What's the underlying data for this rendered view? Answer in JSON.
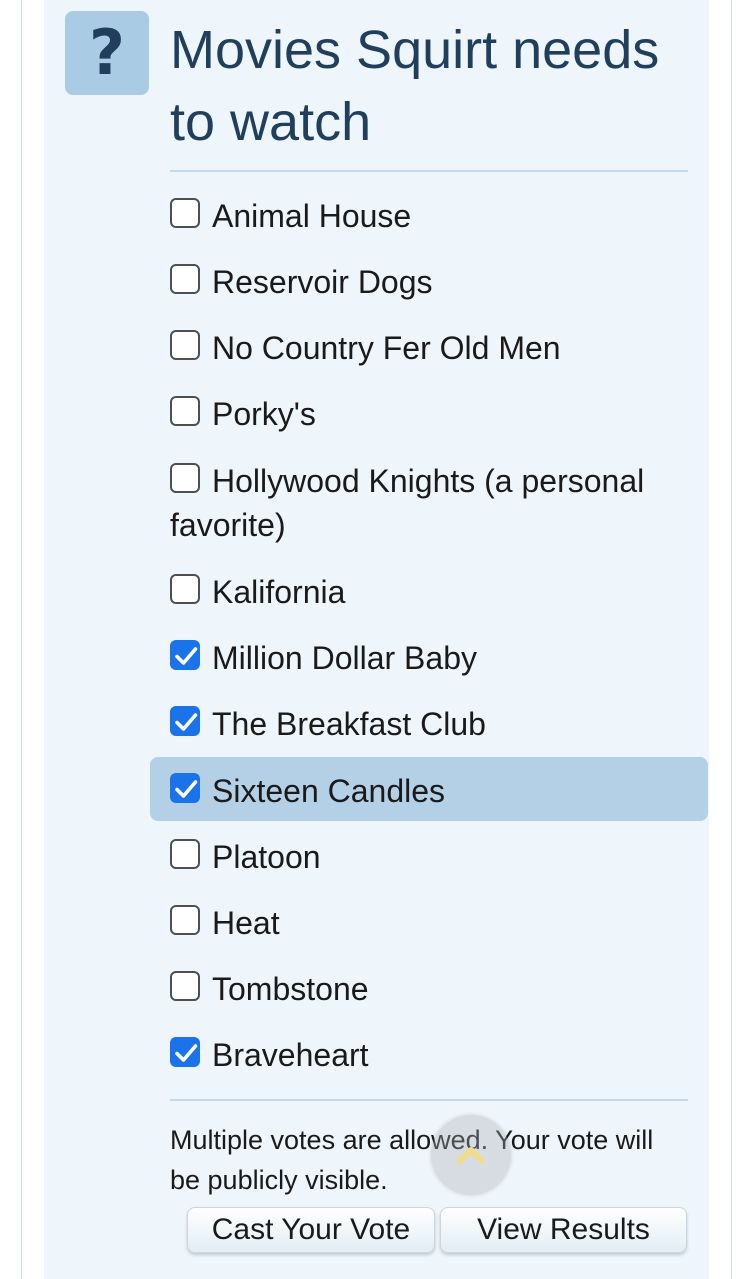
{
  "poll": {
    "icon_glyph": "?",
    "title": "Movies Squirt needs to watch",
    "options": [
      {
        "label": "Animal House",
        "checked": false
      },
      {
        "label": "Reservoir Dogs",
        "checked": false
      },
      {
        "label": "No Country Fer Old Men",
        "checked": false
      },
      {
        "label": "Porky's",
        "checked": false
      },
      {
        "label": "Hollywood Knights (a personal favorite)",
        "checked": false
      },
      {
        "label": "Kalifornia",
        "checked": false
      },
      {
        "label": "Million Dollar Baby",
        "checked": true
      },
      {
        "label": "The Breakfast Club",
        "checked": true
      },
      {
        "label": "Sixteen Candles",
        "checked": true
      },
      {
        "label": "Platoon",
        "checked": false
      },
      {
        "label": "Heat",
        "checked": false
      },
      {
        "label": "Tombstone",
        "checked": false
      },
      {
        "label": "Braveheart",
        "checked": true
      }
    ],
    "note": "Multiple votes are allowed. Your vote will be publicly visible.",
    "cast_vote_label": "Cast Your Vote",
    "view_results_label": "View Results"
  },
  "icons": {
    "question": "question-mark-icon",
    "checkbox_checked": "checkmark-icon",
    "scroll_top": "chevron-up-icon"
  },
  "colors": {
    "card_background": "#eef5fb",
    "accent": "#1a73e8",
    "highlight": "#b3d0e6",
    "title_text": "#1f3f5c",
    "icon_tile": "#a9cbe3"
  }
}
